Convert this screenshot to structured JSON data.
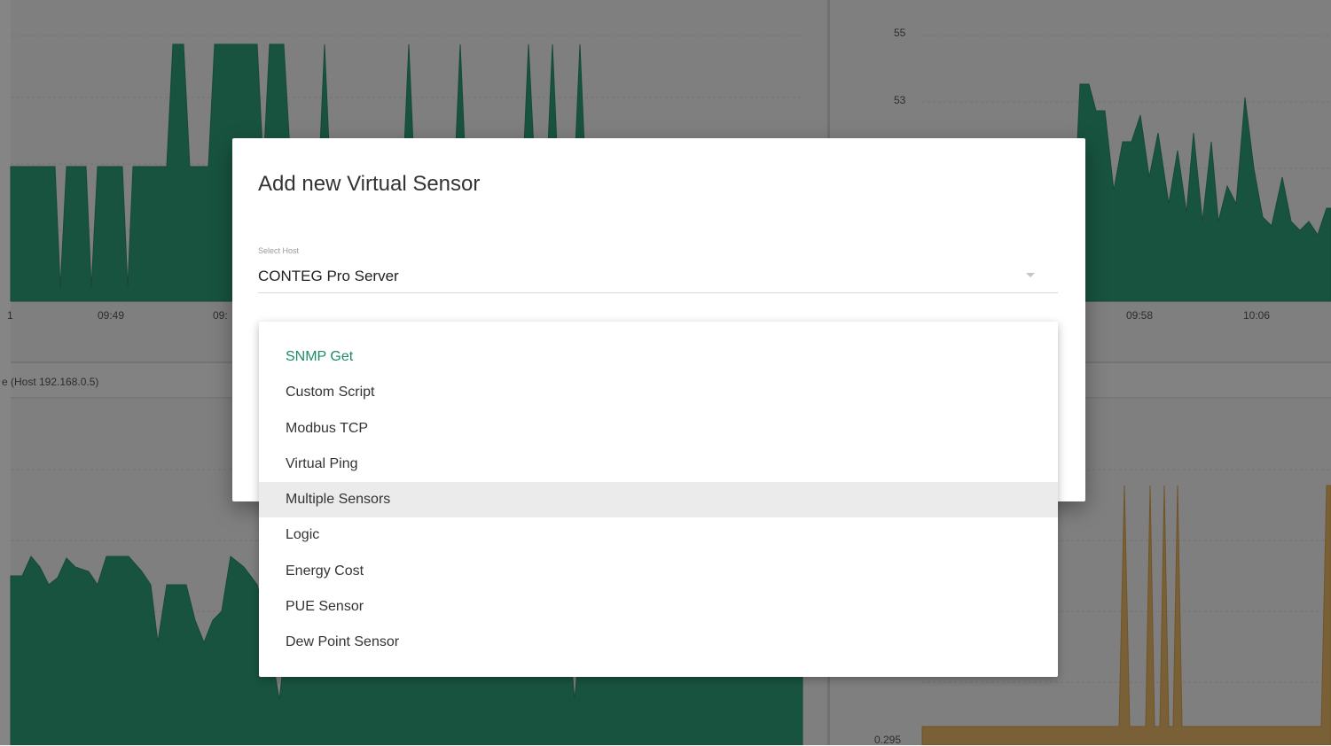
{
  "background": {
    "left_chart": {
      "x_ticks": [
        "1",
        "09:49",
        "09:"
      ],
      "area_color": "#2f9f7c"
    },
    "right_chart": {
      "y_ticks": [
        "55",
        "53"
      ],
      "x_ticks": [
        "09:58",
        "10:06"
      ],
      "area_color": "#2f9f7c"
    },
    "bottom_left_chart": {
      "title": "e (Host 192.168.0.5)",
      "area_color": "#2f9f7c"
    },
    "bottom_right_chart": {
      "y_ticks": [
        "0.295"
      ],
      "area_color": "#e8b86a"
    }
  },
  "dialog": {
    "title": "Add new Virtual Sensor",
    "host_select": {
      "label": "Select Host",
      "value": "CONTEG Pro Server",
      "icon": "dropdown-arrow-icon"
    }
  },
  "sensor_type_menu": {
    "items": [
      "SNMP Get",
      "Custom Script",
      "Modbus TCP",
      "Virtual Ping",
      "Multiple Sensors",
      "Logic",
      "Energy Cost",
      "PUE Sensor",
      "Dew Point Sensor"
    ],
    "selected": "SNMP Get",
    "highlighted": "Multiple Sensors",
    "accent_color": "#1e8b6b"
  }
}
